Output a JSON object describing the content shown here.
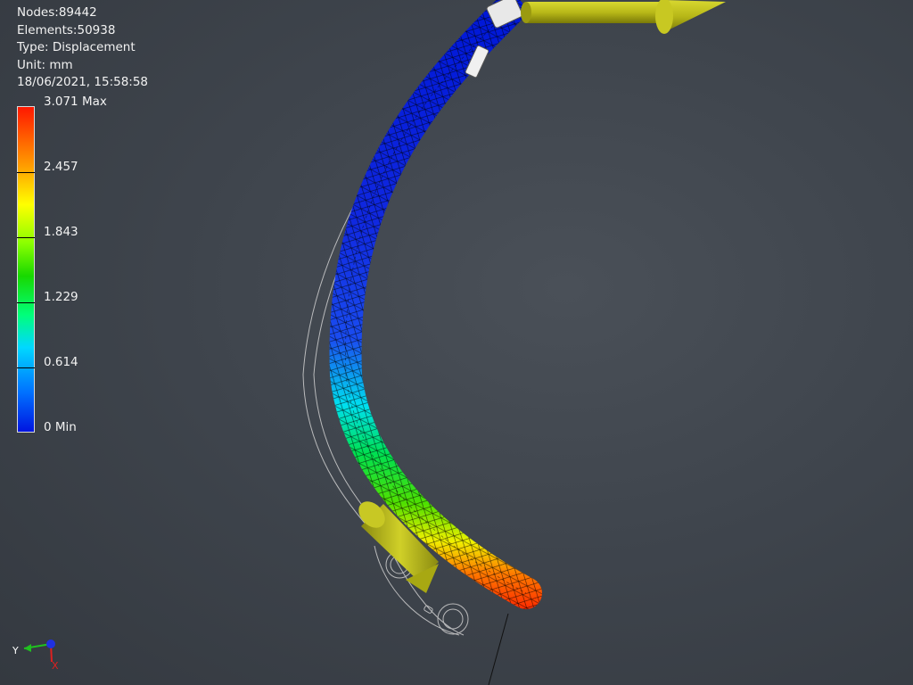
{
  "info": {
    "nodes": "Nodes:89442",
    "elements": "Elements:50938",
    "type": "Type: Displacement",
    "unit": "Unit: mm",
    "timestamp": "18/06/2021, 15:58:58"
  },
  "legend": {
    "labels": [
      "3.071 Max",
      "2.457",
      "1.843",
      "1.229",
      "0.614",
      "0 Min"
    ]
  },
  "triad": {
    "y_label": "Y",
    "x_label": "X"
  },
  "colors": {
    "background": "#3f454d",
    "load_arrow": "#bdbd1a",
    "max": "#ff1800",
    "min": "#0015e0"
  }
}
